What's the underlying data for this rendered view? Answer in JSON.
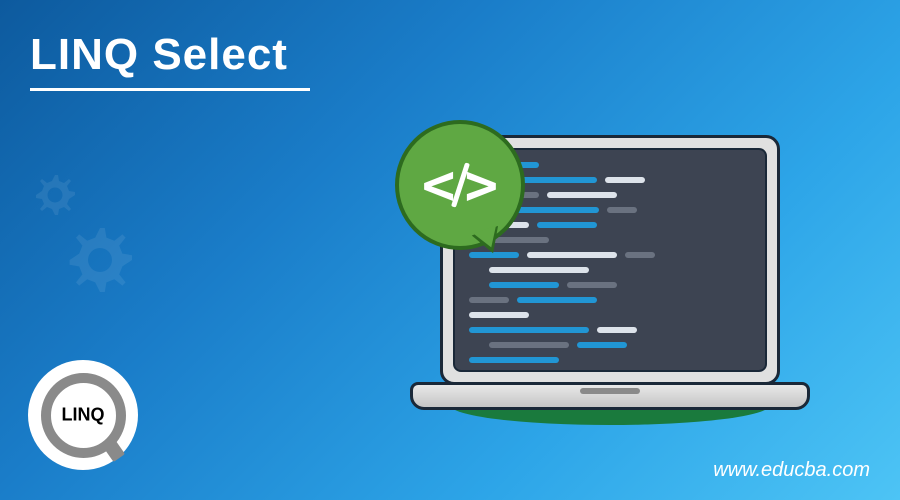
{
  "title": "LINQ Select",
  "logo_text": "LINQ",
  "website": "www.educba.com"
}
